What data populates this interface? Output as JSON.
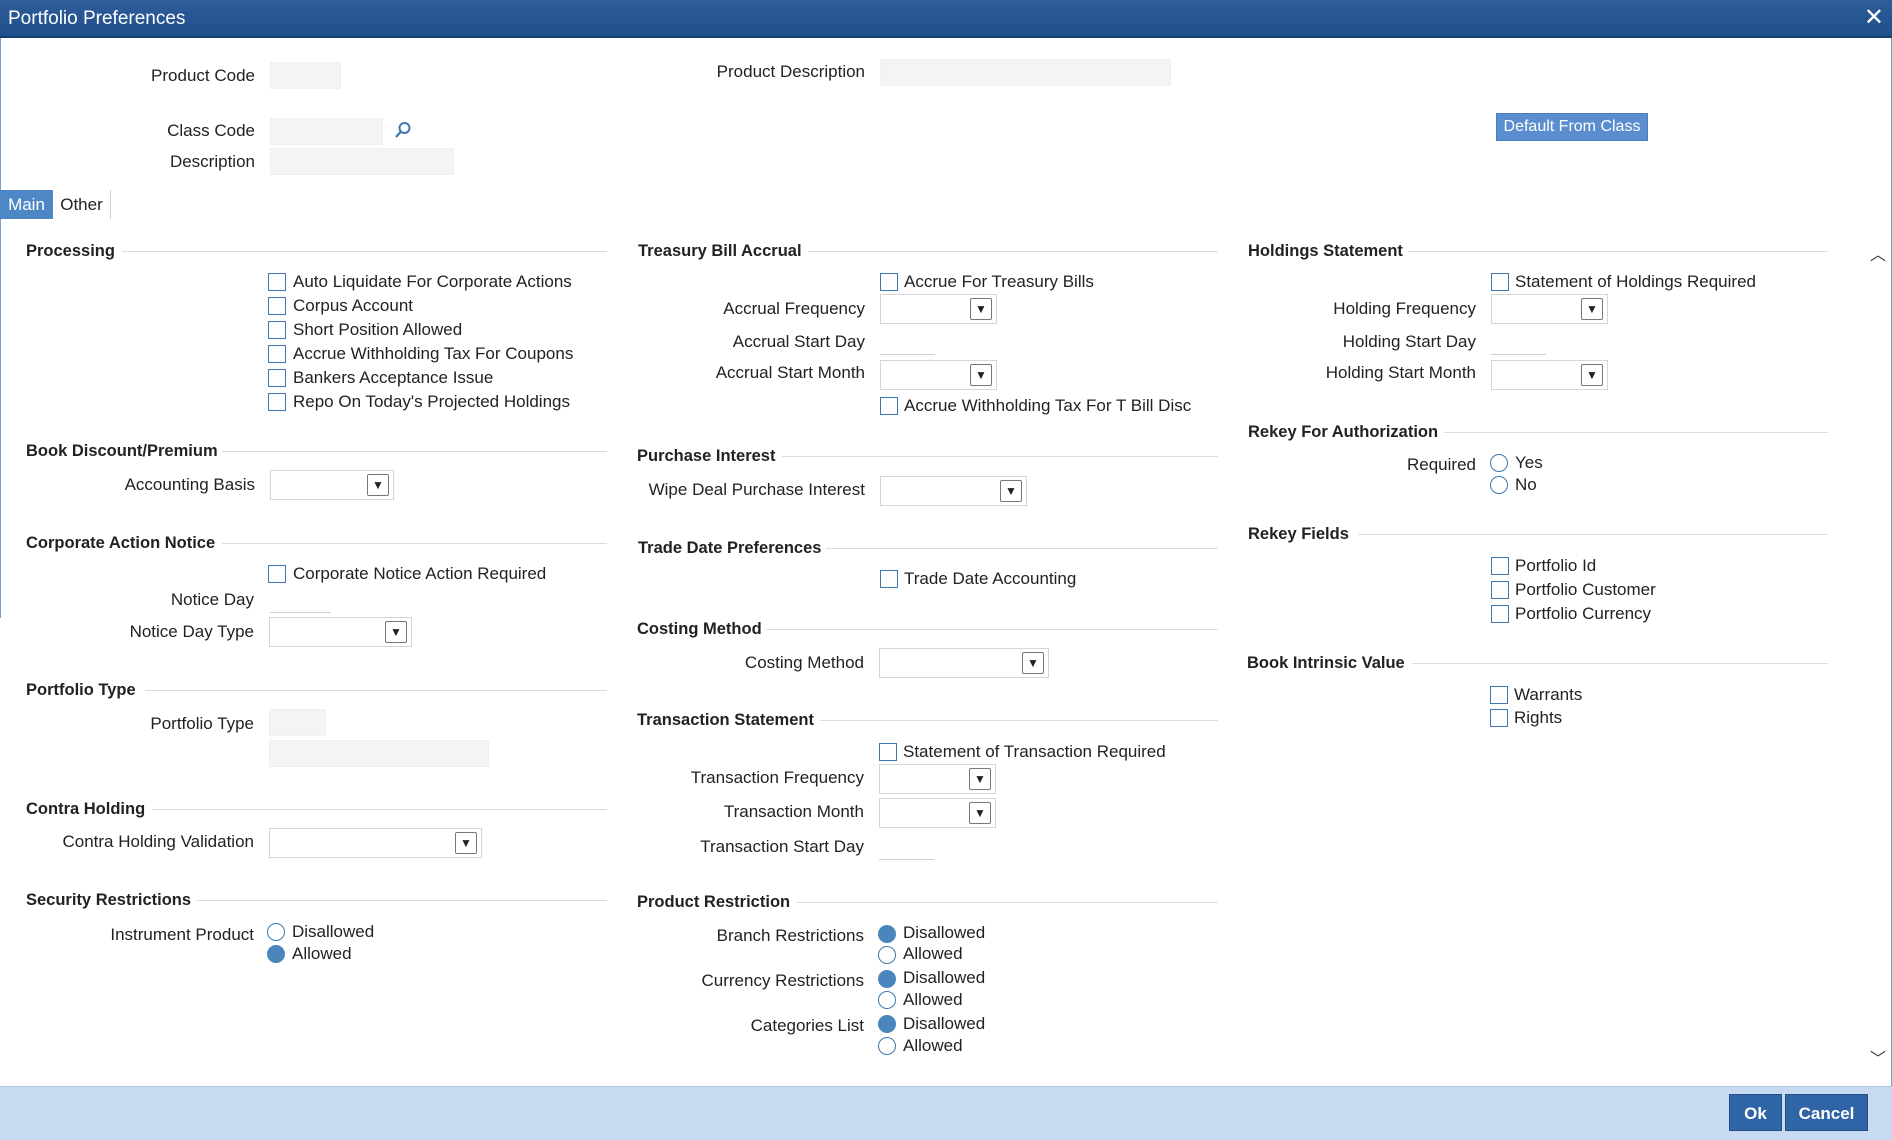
{
  "window": {
    "title": "Portfolio Preferences"
  },
  "header": {
    "product_code_label": "Product Code",
    "product_code_value": "",
    "product_description_label": "Product Description",
    "product_description_value": "",
    "class_code_label": "Class Code",
    "class_code_value": "",
    "description_label": "Description",
    "description_value": "",
    "default_from_class": "Default From Class"
  },
  "tabs": [
    "Main",
    "Other"
  ],
  "processing": {
    "title": "Processing",
    "options": [
      "Auto Liquidate For Corporate Actions",
      "Corpus Account",
      "Short Position Allowed",
      "Accrue Withholding Tax For Coupons",
      "Bankers Acceptance Issue",
      "Repo On Today's Projected Holdings"
    ]
  },
  "book_discount": {
    "title": "Book Discount/Premium",
    "accounting_basis_label": "Accounting Basis",
    "accounting_basis_value": ""
  },
  "corporate_action": {
    "title": "Corporate Action Notice",
    "notice_required": "Corporate Notice Action Required",
    "notice_day_label": "Notice Day",
    "notice_day_type_label": "Notice Day Type"
  },
  "portfolio_type": {
    "title": "Portfolio Type",
    "label": "Portfolio Type"
  },
  "contra_holding": {
    "title": "Contra Holding",
    "validation_label": "Contra Holding Validation"
  },
  "security_restrictions": {
    "title": "Security Restrictions",
    "instrument_product_label": "Instrument Product",
    "options": [
      "Disallowed",
      "Allowed"
    ],
    "selected": "Allowed"
  },
  "treasury": {
    "title": "Treasury Bill Accrual",
    "accrue_label": "Accrue For Treasury Bills",
    "frequency_label": "Accrual Frequency",
    "start_day_label": "Accrual Start Day",
    "start_month_label": "Accrual Start Month",
    "withholding_label": "Accrue Withholding Tax For T Bill Disc"
  },
  "purchase_interest": {
    "title": "Purchase Interest",
    "wipe_label": "Wipe Deal Purchase Interest"
  },
  "trade_date": {
    "title": "Trade Date Preferences",
    "accounting_label": "Trade Date Accounting"
  },
  "costing": {
    "title": "Costing Method",
    "label": "Costing Method"
  },
  "transaction_statement": {
    "title": "Transaction Statement",
    "required_label": "Statement of Transaction Required",
    "frequency_label": "Transaction Frequency",
    "month_label": "Transaction Month",
    "start_day_label": "Transaction Start Day"
  },
  "product_restriction": {
    "title": "Product Restriction",
    "rows": [
      {
        "label": "Branch Restrictions",
        "selected": "Disallowed"
      },
      {
        "label": "Currency Restrictions",
        "selected": "Disallowed"
      },
      {
        "label": "Categories List",
        "selected": "Disallowed"
      }
    ],
    "options": [
      "Disallowed",
      "Allowed"
    ]
  },
  "holdings": {
    "title": "Holdings Statement",
    "required_label": "Statement of Holdings Required",
    "frequency_label": "Holding Frequency",
    "start_day_label": "Holding Start Day",
    "start_month_label": "Holding Start Month"
  },
  "rekey_auth": {
    "title": "Rekey For Authorization",
    "required_label": "Required",
    "options": [
      "Yes",
      "No"
    ]
  },
  "rekey_fields": {
    "title": "Rekey Fields",
    "options": [
      "Portfolio Id",
      "Portfolio Customer",
      "Portfolio Currency"
    ]
  },
  "intrinsic": {
    "title": "Book Intrinsic Value",
    "options": [
      "Warrants",
      "Rights"
    ]
  },
  "footer": {
    "ok": "Ok",
    "cancel": "Cancel"
  },
  "colors": {
    "title_bar": "#1f4f8c",
    "accent": "#4e87c6",
    "footer": "#c7daf1"
  }
}
